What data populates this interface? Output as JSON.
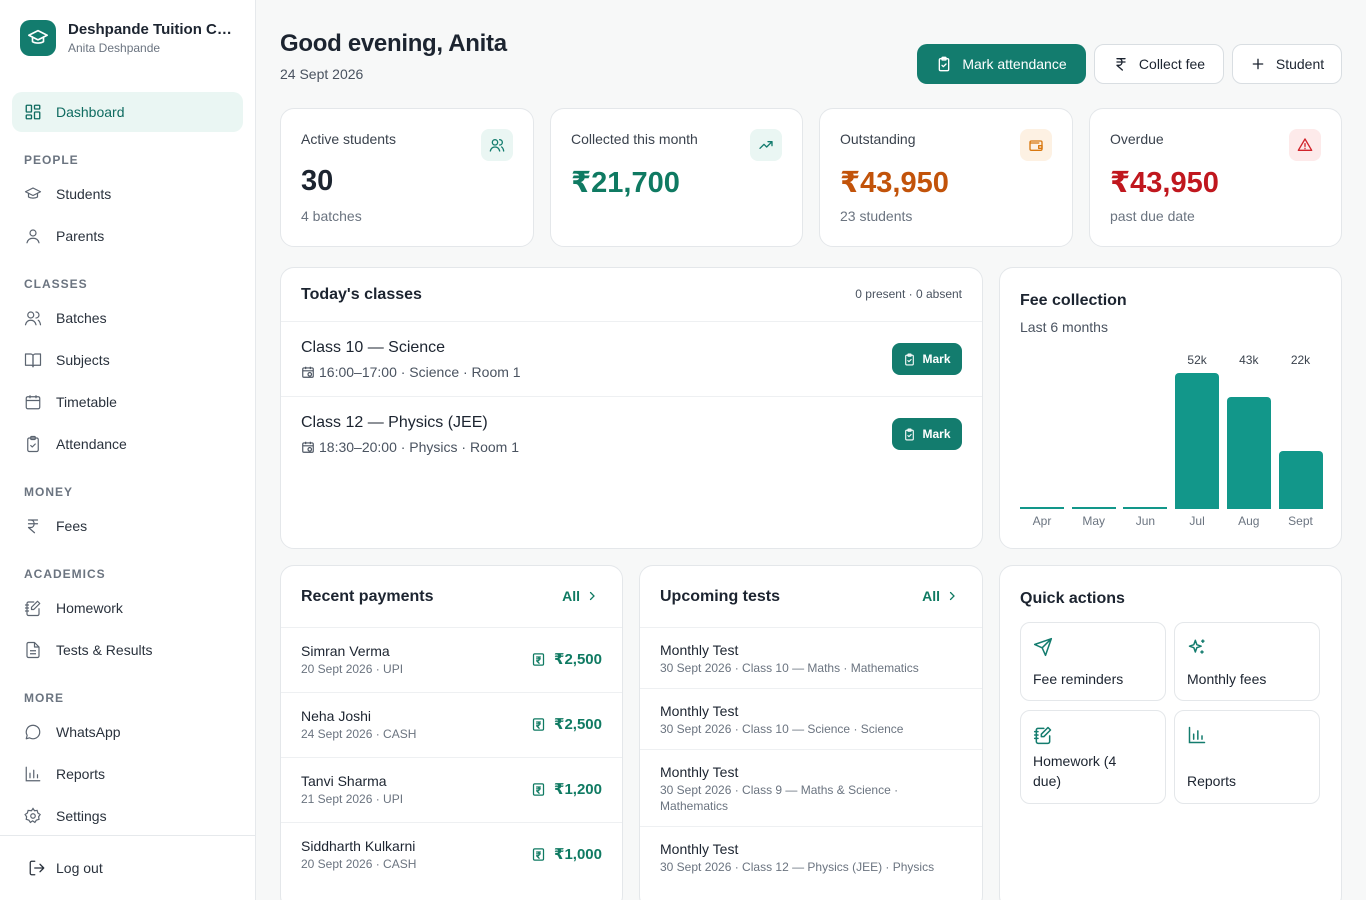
{
  "brand": {
    "name": "Deshpande Tuition Classes",
    "owner": "Anita Deshpande"
  },
  "sidebar": {
    "dashboard": "Dashboard",
    "sections": {
      "people": "PEOPLE",
      "classes": "CLASSES",
      "money": "MONEY",
      "academics": "ACADEMICS",
      "more": "MORE"
    },
    "items": {
      "students": "Students",
      "parents": "Parents",
      "batches": "Batches",
      "subjects": "Subjects",
      "timetable": "Timetable",
      "attendance": "Attendance",
      "fees": "Fees",
      "homework": "Homework",
      "tests": "Tests & Results",
      "whatsapp": "WhatsApp",
      "reports": "Reports",
      "settings": "Settings"
    },
    "logout": "Log out"
  },
  "header": {
    "greeting": "Good evening, Anita",
    "date": "24 Sept 2026",
    "mark_attendance": "Mark attendance",
    "collect_fee": "Collect fee",
    "add_student": "Student"
  },
  "stats": {
    "active": {
      "label": "Active students",
      "value": "30",
      "sub": "4 batches"
    },
    "collected": {
      "label": "Collected this month",
      "value": "₹21,700"
    },
    "outstanding": {
      "label": "Outstanding",
      "value": "₹43,950",
      "sub": "23 students"
    },
    "overdue": {
      "label": "Overdue",
      "value": "₹43,950",
      "sub": "past due date"
    }
  },
  "today_classes": {
    "title": "Today's classes",
    "summary": "0 present · 0 absent",
    "mark_label": "Mark",
    "items": [
      {
        "name": "Class 10 — Science",
        "meta": "16:00–17:00 · Science · Room 1"
      },
      {
        "name": "Class 12 — Physics (JEE)",
        "meta": "18:30–20:00 · Physics · Room 1"
      }
    ]
  },
  "fee_collection": {
    "title": "Fee collection",
    "subtitle": "Last 6 months"
  },
  "chart_data": {
    "type": "bar",
    "categories": [
      "Apr",
      "May",
      "Jun",
      "Jul",
      "Aug",
      "Sept"
    ],
    "values": [
      0,
      0,
      0,
      52000,
      43000,
      22000
    ],
    "value_labels": [
      "",
      "",
      "",
      "52k",
      "43k",
      "22k"
    ],
    "title": "Fee collection",
    "subtitle": "Last 6 months",
    "ylim": [
      0,
      52000
    ],
    "grid": false,
    "color": "#12978a"
  },
  "recent_payments": {
    "title": "Recent payments",
    "all_label": "All",
    "items": [
      {
        "name": "Simran Verma",
        "meta": "20 Sept 2026 · UPI",
        "amount": "₹2,500"
      },
      {
        "name": "Neha Joshi",
        "meta": "24 Sept 2026 · CASH",
        "amount": "₹2,500"
      },
      {
        "name": "Tanvi Sharma",
        "meta": "21 Sept 2026 · UPI",
        "amount": "₹1,200"
      },
      {
        "name": "Siddharth Kulkarni",
        "meta": "20 Sept 2026 · CASH",
        "amount": "₹1,000"
      }
    ]
  },
  "upcoming_tests": {
    "title": "Upcoming tests",
    "all_label": "All",
    "items": [
      {
        "name": "Monthly Test",
        "meta": "30 Sept 2026 · Class 10 — Maths · Mathematics"
      },
      {
        "name": "Monthly Test",
        "meta": "30 Sept 2026 · Class 10 — Science · Science"
      },
      {
        "name": "Monthly Test",
        "meta": "30 Sept 2026 · Class 9 — Maths & Science · Mathematics"
      },
      {
        "name": "Monthly Test",
        "meta": "30 Sept 2026 · Class 12 — Physics (JEE) · Physics"
      }
    ]
  },
  "quick_actions": {
    "title": "Quick actions",
    "fee_reminders": "Fee reminders",
    "monthly_fees": "Monthly fees",
    "homework": "Homework (4 due)",
    "reports": "Reports"
  },
  "colors": {
    "accent": "#137c6e",
    "collected": "#0f7a62",
    "outstanding": "#c2530a",
    "overdue": "#c0171e"
  }
}
